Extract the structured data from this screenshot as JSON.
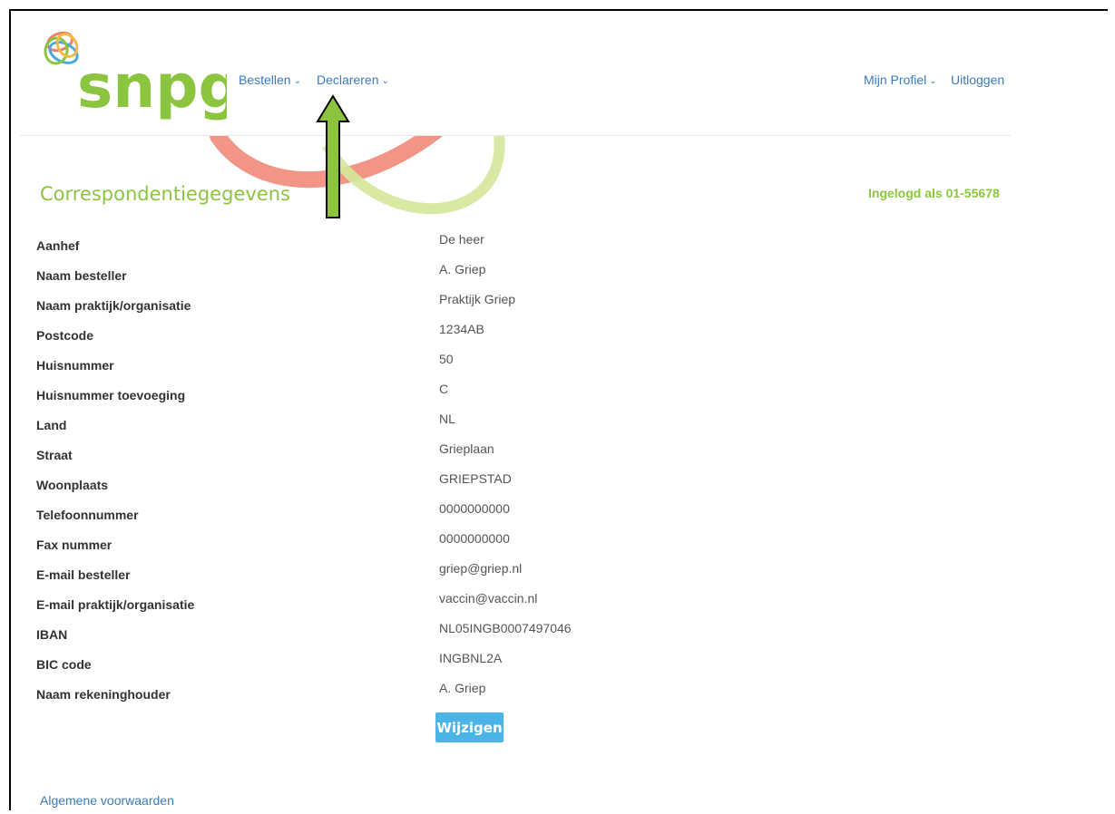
{
  "brand": {
    "logo_text": "snpg",
    "color": "#8bc53f"
  },
  "nav": {
    "left": [
      {
        "label": "Bestellen",
        "icon": "chevron-down-icon"
      },
      {
        "label": "Declareren",
        "icon": "chevron-down-icon"
      }
    ],
    "right": [
      {
        "label": "Mijn Profiel",
        "icon": "chevron-down-icon"
      },
      {
        "label": "Uitloggen"
      }
    ]
  },
  "page": {
    "title": "Correspondentiegegevens",
    "logged_in": "Ingelogd als 01-55678"
  },
  "fields": [
    {
      "label": "Aanhef",
      "value": "De heer"
    },
    {
      "label": "Naam besteller",
      "value": "A. Griep"
    },
    {
      "label": "Naam praktijk/organisatie",
      "value": "Praktijk Griep"
    },
    {
      "label": "Postcode",
      "value": "1234AB"
    },
    {
      "label": "Huisnummer",
      "value": "50"
    },
    {
      "label": "Huisnummer toevoeging",
      "value": "C"
    },
    {
      "label": "Land",
      "value": "NL"
    },
    {
      "label": "Straat",
      "value": "Grieplaan"
    },
    {
      "label": "Woonplaats",
      "value": "GRIEPSTAD"
    },
    {
      "label": "Telefoonnummer",
      "value": "0000000000"
    },
    {
      "label": "Fax nummer",
      "value": "0000000000"
    },
    {
      "label": "E-mail besteller",
      "value": "griep@griep.nl"
    },
    {
      "label": "E-mail praktijk/organisatie",
      "value": "vaccin@vaccin.nl"
    },
    {
      "label": "IBAN",
      "value": "NL05INGB0007497046"
    },
    {
      "label": "BIC code",
      "value": "INGBNL2A"
    },
    {
      "label": "Naam rekeninghouder",
      "value": "A. Griep"
    }
  ],
  "actions": {
    "edit_label": "Wijzigen"
  },
  "footer": {
    "terms_label": "Algemene voorwaarden"
  },
  "colors": {
    "link": "#3a7bbf",
    "accent_green": "#8bc53f",
    "button": "#4ab4e6",
    "deco_red": "#f08a7c",
    "deco_green": "#c8e08a"
  }
}
